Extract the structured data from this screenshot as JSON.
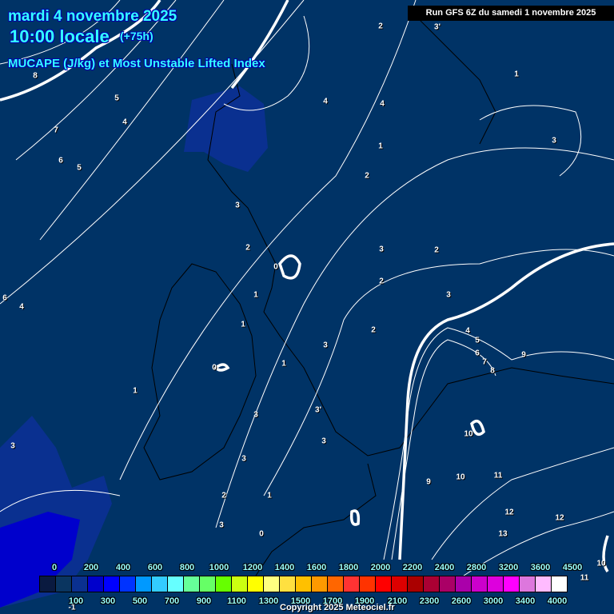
{
  "header": {
    "date": "mardi 4 novembre 2025",
    "time": "10:00 locale",
    "lead": "(+75h)",
    "subtitle": "MUCAPE (J/kg) et Most Unstable Lifted Index",
    "run": "Run GFS 6Z du samedi 1 novembre 2025"
  },
  "colorbar": {
    "colors": [
      "#0a1a40",
      "#0a3560",
      "#0a3090",
      "#0000cc",
      "#0000ff",
      "#0033ff",
      "#0099ff",
      "#33ccff",
      "#66ffff",
      "#66ff99",
      "#66ff66",
      "#66ff00",
      "#ccff11",
      "#ffff00",
      "#ffff80",
      "#ffe040",
      "#ffc000",
      "#ff9900",
      "#ff6600",
      "#ff3333",
      "#ff3300",
      "#ff0000",
      "#dd0000",
      "#aa0000",
      "#aa0033",
      "#aa0066",
      "#aa00aa",
      "#cc00cc",
      "#dd00dd",
      "#ff00ff",
      "#dd77dd",
      "#ffbbff",
      "#ffffff"
    ],
    "top_labels": [
      "0",
      "200",
      "400",
      "600",
      "800",
      "1000",
      "1200",
      "1400",
      "1600",
      "1800",
      "2000",
      "2200",
      "2400",
      "2800",
      "3200",
      "3600",
      "4500"
    ],
    "bottom_labels": [
      "100",
      "300",
      "500",
      "700",
      "900",
      "1100",
      "1300",
      "1500",
      "1700",
      "1900",
      "2100",
      "2300",
      "2600",
      "3000",
      "3400",
      "4000"
    ]
  },
  "contour_labels": [
    "8",
    "5",
    "4",
    "7",
    "6",
    "5",
    "2",
    "3'",
    "1",
    "4",
    "4",
    "3",
    "1",
    "2",
    "3",
    "2",
    "0",
    "3",
    "2",
    "2",
    "1",
    "3",
    "4",
    "5",
    "6",
    "7",
    "8",
    "9",
    "1",
    "0",
    "1",
    "2",
    "3",
    "1",
    "3'",
    "3",
    "3",
    "10",
    "10",
    "11",
    "9",
    "12",
    "12",
    "13",
    "11",
    "10",
    "6",
    "4",
    "3",
    "3",
    "1",
    "0",
    "-1",
    "2",
    "3"
  ],
  "copyright": "Copyright 2025 Meteociel.fr"
}
